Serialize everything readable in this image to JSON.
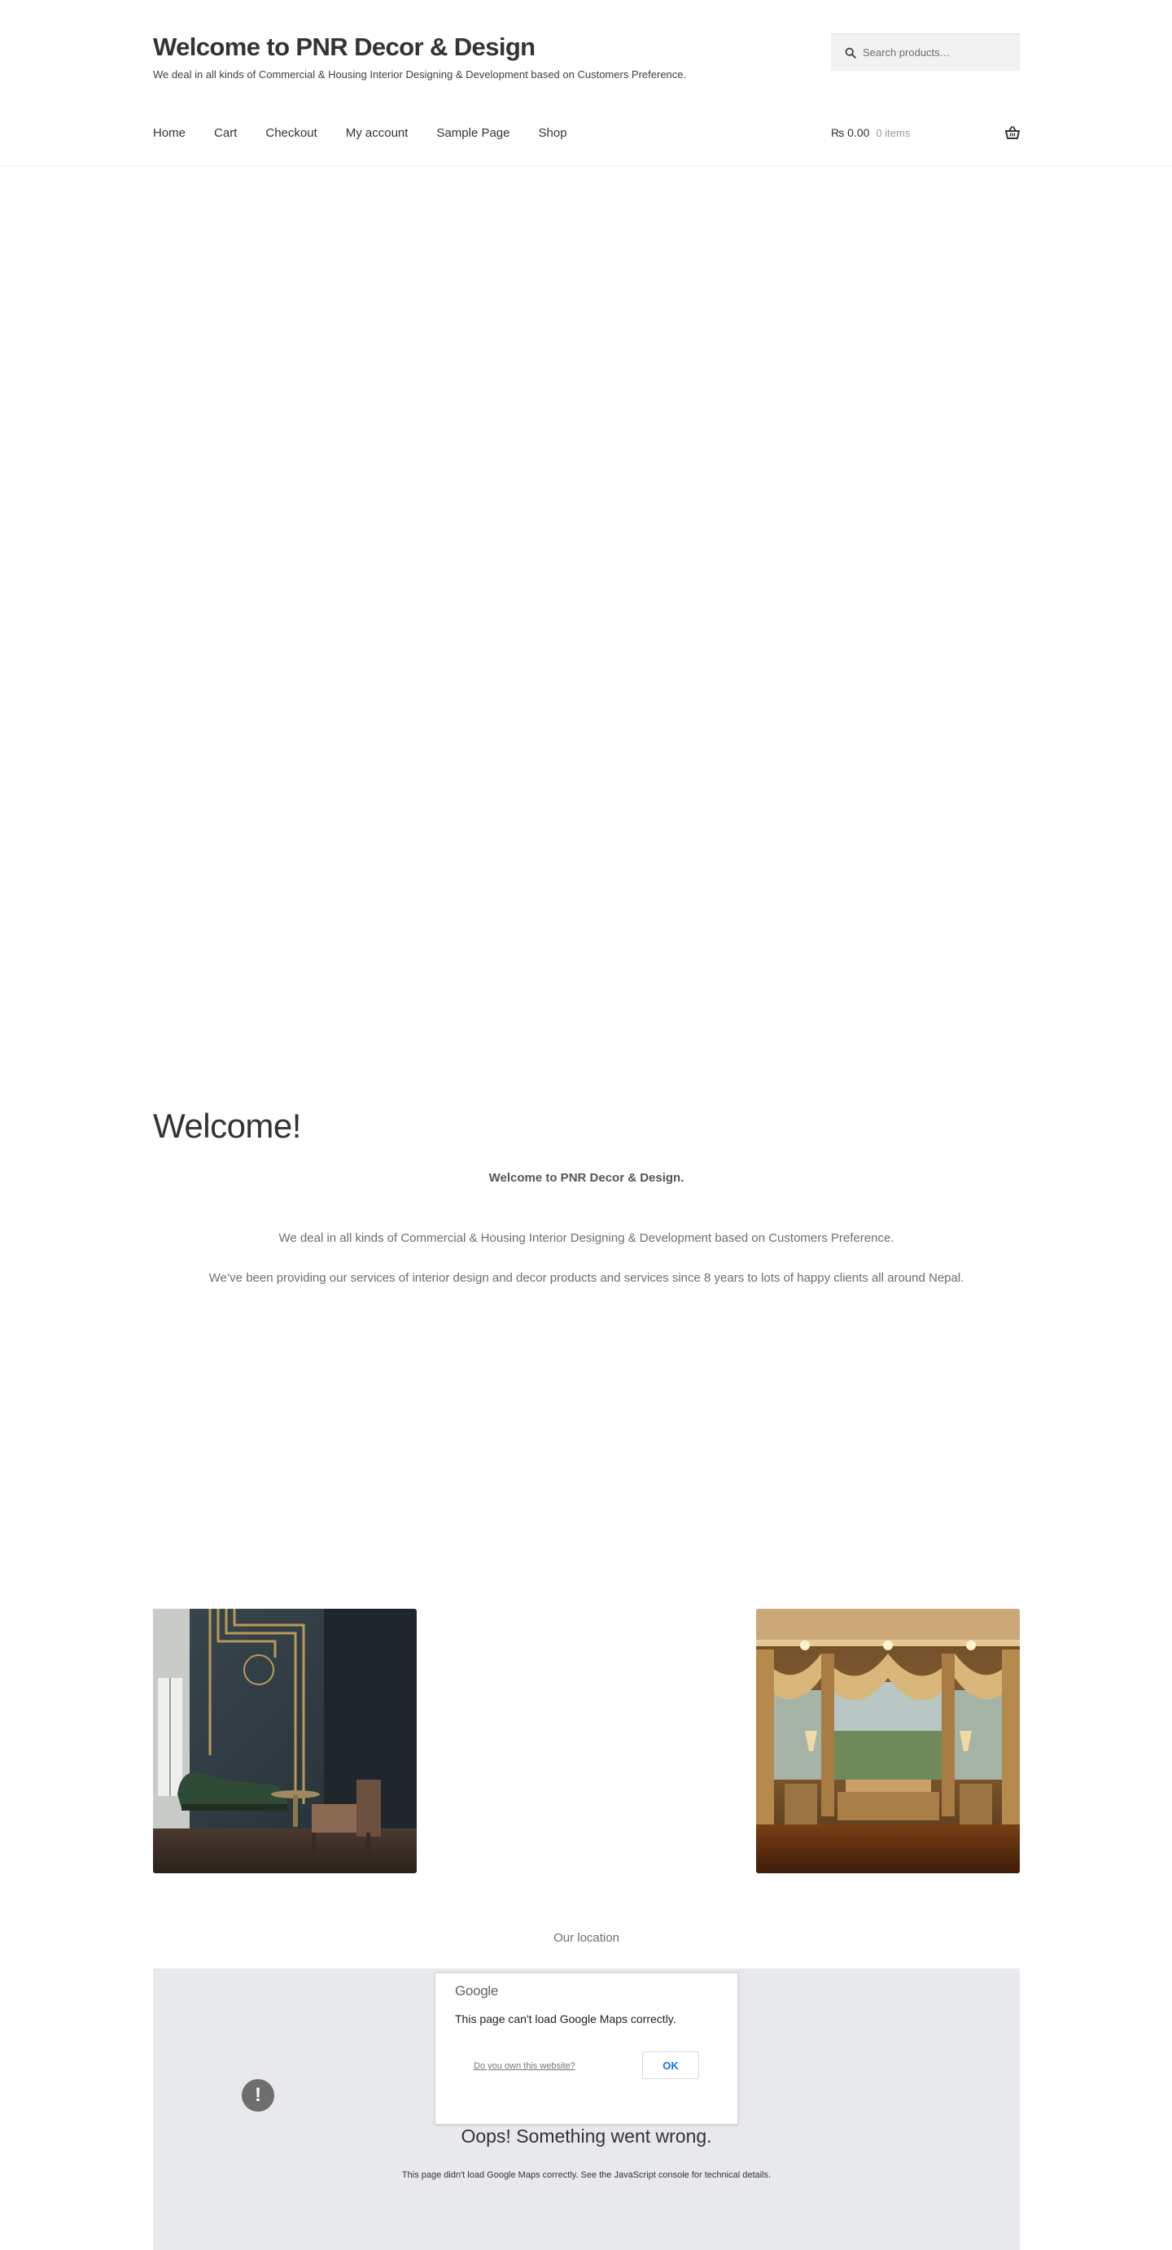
{
  "header": {
    "site_title": "Welcome to PNR Decor & Design",
    "tagline": "We deal in all kinds of Commercial & Housing Interior Designing & Development based on Customers Preference.",
    "search_placeholder": "Search products…",
    "nav": [
      "Home",
      "Cart",
      "Checkout",
      "My account",
      "Sample Page",
      "Shop"
    ],
    "cart_amount": "₨ 0.00",
    "cart_count": "0 items"
  },
  "welcome": {
    "heading": "Welcome!",
    "bold_line": "Welcome to PNR Decor & Design.",
    "paragraph1": "We deal in all kinds of Commercial & Housing Interior Designing & Development based on Customers Preference.",
    "paragraph2": "We’ve been providing our services of interior design and decor products and services since 8 years to lots of happy clients all around Nepal."
  },
  "gallery": {
    "left_image": "modern-living-room-image",
    "right_image": "curtain-window-room-image"
  },
  "location": {
    "label": "Our location",
    "dialog_logo": "Google",
    "dialog_message": "This page can't load Google Maps correctly.",
    "dialog_link": "Do you own this website?",
    "ok_label": "OK",
    "error_icon_glyph": "!",
    "oops_title": "Oops! Something went wrong.",
    "oops_detail": "This page didn't load Google Maps correctly. See the JavaScript console for technical details."
  },
  "colors": {
    "title": "#333333",
    "link_blue": "#1a73e8",
    "map_bg": "#e8e9ed"
  }
}
